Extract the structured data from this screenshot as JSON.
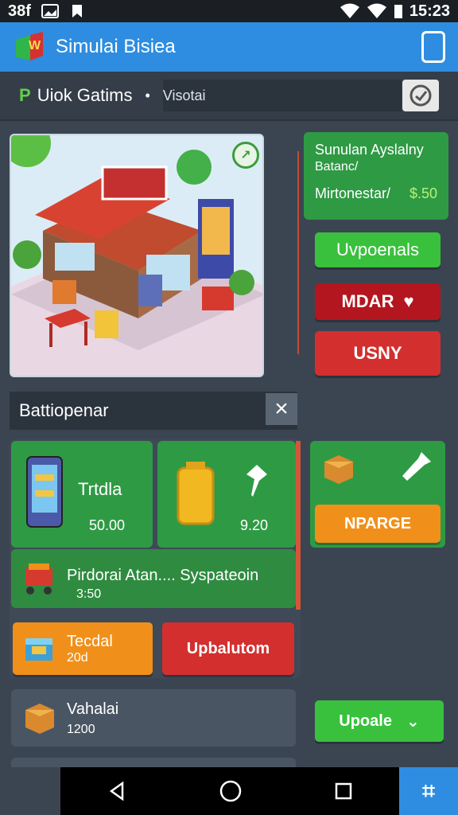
{
  "status": {
    "left_text": "38f",
    "time": "15:23"
  },
  "app": {
    "title": "Simulai Bisiea"
  },
  "subbar": {
    "title": "Uiok Gatims",
    "separator": "•",
    "field": "Visotai"
  },
  "side": {
    "title": "Sunulan Ayslalny",
    "subtitle": "Batanc/",
    "row_label": "Mirtonestar/",
    "price": "$.50",
    "btn_green": "Uvpoenals",
    "btn_red1": "MDAR",
    "btn_red2": "USNY"
  },
  "section": {
    "title": "Battiopenar"
  },
  "cards": {
    "card1_label": "Trtdla",
    "card1_value": "50.00",
    "card2_value": "9.20",
    "row_title": "Pirdorai Atan.... Syspateoin",
    "row_value": "3:50",
    "upgrade_btn": "NPARGE",
    "orange_title": "Tecdal",
    "orange_value": "20d",
    "red_btn": "Upbalutom",
    "bottom_title": "Vahalai",
    "bottom_value": "1200",
    "update_btn": "Upoale"
  },
  "colors": {
    "app_blue": "#2e8de0",
    "green": "#2f9a44",
    "bright_green": "#39c13d",
    "red": "#d32f2f",
    "orange": "#f0901a"
  }
}
